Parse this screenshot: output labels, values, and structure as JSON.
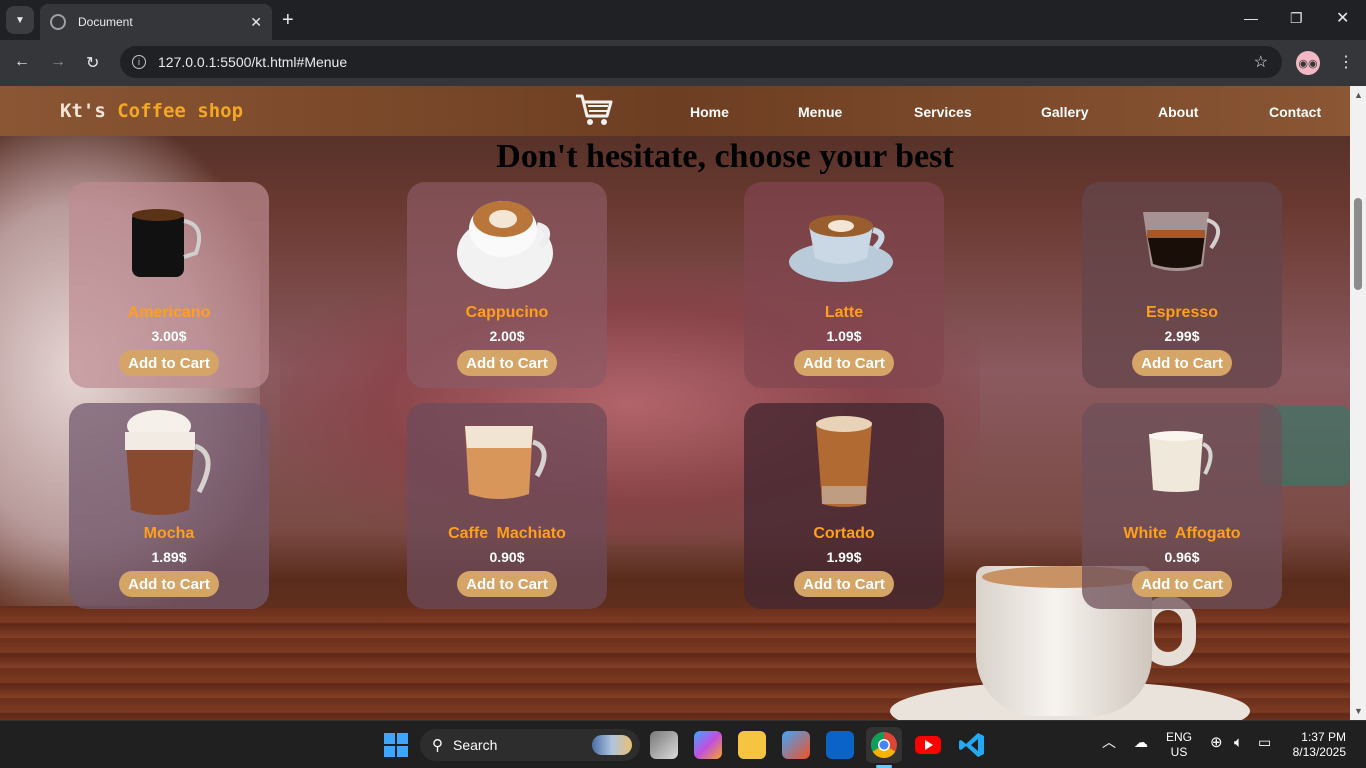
{
  "browser": {
    "tab_title": "Document",
    "url": "127.0.0.1:5500/kt.html#Menue"
  },
  "site": {
    "brand_prefix": "Kt's",
    "brand_accent": "Coffee shop",
    "nav": [
      "Home",
      "Menue",
      "Services",
      "Gallery",
      "About",
      "Contact"
    ],
    "headline": "Don't hesitate, choose your best"
  },
  "products": [
    {
      "name": "Americano",
      "price": "3.00$",
      "button": "Add to Cart"
    },
    {
      "name": "Cappucino",
      "price": "2.00$",
      "button": "Add to Cart"
    },
    {
      "name": "Latte",
      "price": "1.09$",
      "button": "Add to Cart"
    },
    {
      "name": "Espresso",
      "price": "2.99$",
      "button": "Add to Cart"
    },
    {
      "name": "Mocha",
      "price": "1.89$",
      "button": "Add to Cart"
    },
    {
      "name": "Caffe  Machiato",
      "price": "0.90$",
      "button": "Add to Cart"
    },
    {
      "name": "Cortado",
      "price": "1.99$",
      "button": "Add to Cart"
    },
    {
      "name": "White  Affogato",
      "price": "0.96$",
      "button": "Add to Cart"
    }
  ],
  "taskbar": {
    "search_label": "Search",
    "lang_top": "ENG",
    "lang_bottom": "US",
    "time": "1:37 PM",
    "date": "8/13/2025"
  },
  "colors": {
    "accent": "#ff9f1a",
    "button": "#d4a567",
    "header": "#6e3e22"
  }
}
